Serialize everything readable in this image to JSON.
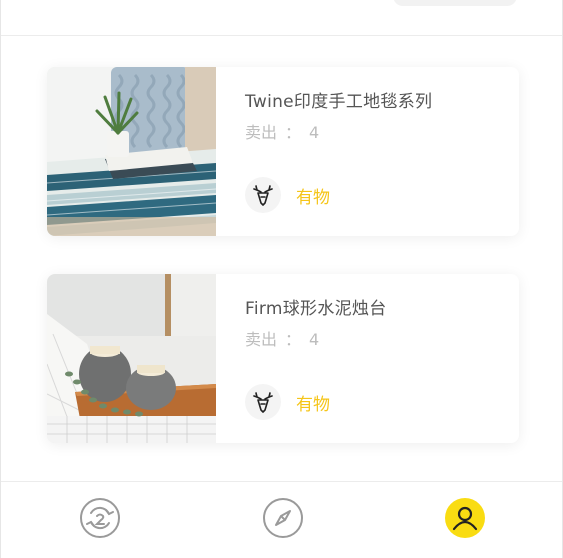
{
  "products": [
    {
      "title": "Twine印度手工地毯系列",
      "sold_label": "卖出",
      "sold_sep": "：",
      "sold_count": "4",
      "brand_name": "有物",
      "image_icon": "woven-rug-photo"
    },
    {
      "title": "Firm球形水泥烛台",
      "sold_label": "卖出",
      "sold_sep": "：",
      "sold_count": "4",
      "brand_name": "有物",
      "image_icon": "concrete-candle-holder-photo"
    }
  ],
  "tabbar": {
    "items": [
      {
        "icon": "refresh-icon",
        "active": false
      },
      {
        "icon": "compass-icon",
        "active": false
      },
      {
        "icon": "user-icon",
        "active": true
      }
    ]
  },
  "colors": {
    "accent": "#f5c518",
    "title_text": "#555555",
    "muted_text": "#bdbdbd",
    "tab_icon": "#9a9a9a",
    "active_tab_bg": "#f9dc12"
  }
}
